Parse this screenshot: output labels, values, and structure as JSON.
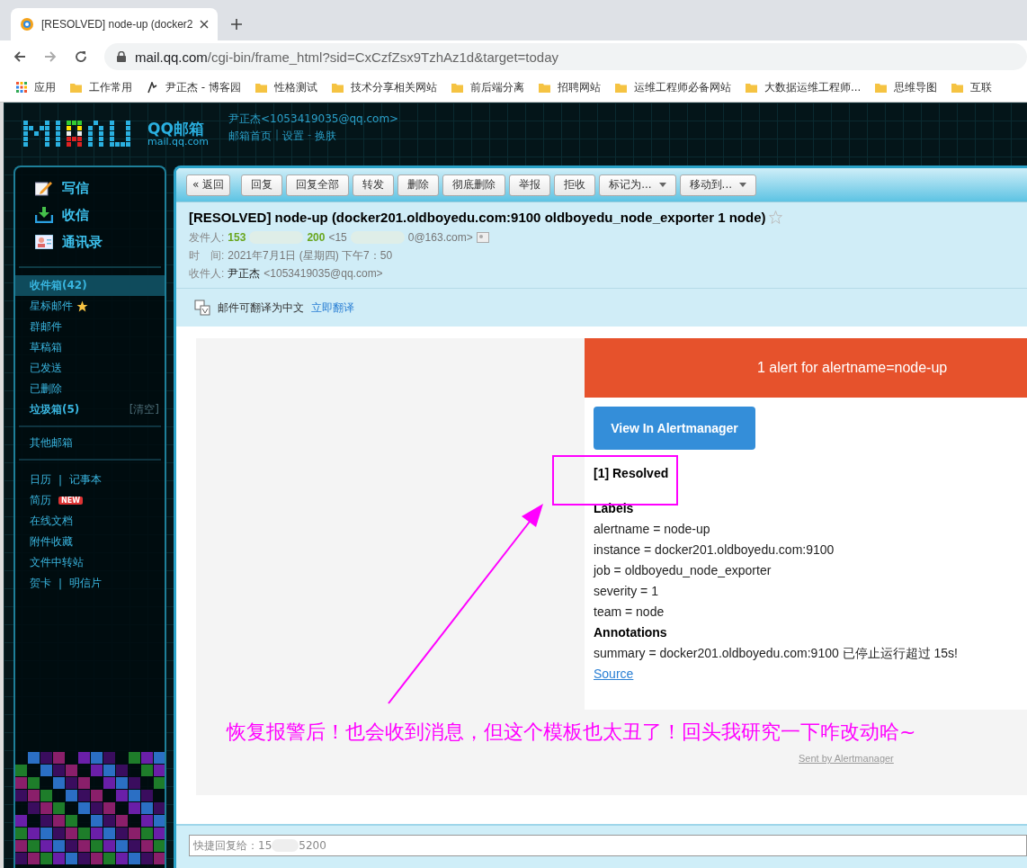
{
  "browser": {
    "tab_title": "[RESOLVED] node-up (docker2",
    "url_host": "mail.qq.com",
    "url_path": "/cgi-bin/frame_html?sid=CxCzfZsx9TzhAz1d&target=today",
    "bookmarks": [
      {
        "kind": "apps",
        "label": "应用"
      },
      {
        "kind": "folder",
        "label": "工作常用"
      },
      {
        "kind": "site",
        "label": "尹正杰 - 博客园"
      },
      {
        "kind": "folder",
        "label": "性格测试"
      },
      {
        "kind": "folder",
        "label": "技术分享相关网站"
      },
      {
        "kind": "folder",
        "label": "前后端分离"
      },
      {
        "kind": "folder",
        "label": "招聘网站"
      },
      {
        "kind": "folder",
        "label": "运维工程师必备网站"
      },
      {
        "kind": "folder",
        "label": "大数据运维工程师..."
      },
      {
        "kind": "folder",
        "label": "思维导图"
      },
      {
        "kind": "folder",
        "label": "互联"
      }
    ]
  },
  "header": {
    "brand": "QQ邮箱",
    "domain": "mail.qq.com",
    "user": "尹正杰<1053419035@qq.com>",
    "links": [
      "邮箱首页",
      "设置",
      "换肤"
    ],
    "separators": [
      "|",
      "-"
    ]
  },
  "sidebar": {
    "actions": [
      {
        "kind": "write",
        "label": "写信"
      },
      {
        "kind": "inbox",
        "label": "收信"
      },
      {
        "kind": "contacts",
        "label": "通讯录"
      }
    ],
    "folders": [
      {
        "label": "收件箱(42)",
        "bold": true,
        "selected": true
      },
      {
        "label": "星标邮件",
        "bold": false,
        "selected": false,
        "starred": true
      },
      {
        "label": "群邮件",
        "bold": false,
        "selected": false
      },
      {
        "label": "草稿箱",
        "bold": false,
        "selected": false
      },
      {
        "label": "已发送",
        "bold": false,
        "selected": false
      },
      {
        "label": "已删除",
        "bold": false,
        "selected": false
      },
      {
        "label": "垃圾箱(5)",
        "bold": true,
        "selected": false,
        "action": "[清空]"
      }
    ],
    "other": "其他邮箱",
    "separator": "|",
    "tools": [
      {
        "links": [
          "日历",
          "记事本"
        ]
      },
      {
        "links": [
          "简历"
        ],
        "badge": "NEW"
      },
      {
        "links": [
          "在线文档"
        ]
      },
      {
        "links": [
          "附件收藏"
        ]
      },
      {
        "links": [
          "文件中转站"
        ]
      },
      {
        "links": [
          "贺卡",
          "明信片"
        ]
      }
    ]
  },
  "toolbar": [
    {
      "label": "« 返回",
      "dropdown": false
    },
    {
      "label": "回复",
      "dropdown": false
    },
    {
      "label": "回复全部",
      "dropdown": false
    },
    {
      "label": "转发",
      "dropdown": false
    },
    {
      "label": "删除",
      "dropdown": false
    },
    {
      "label": "彻底删除",
      "dropdown": false
    },
    {
      "label": "举报",
      "dropdown": false
    },
    {
      "label": "拒收",
      "dropdown": false
    },
    {
      "label": "标记为...",
      "dropdown": true
    },
    {
      "label": "移动到...",
      "dropdown": true
    }
  ],
  "message": {
    "subject": "[RESOLVED] node-up (docker201.oldboyedu.com:9100 oldboyedu_node_exporter 1 node)",
    "from_label": "发件人:",
    "from_name_start": "153",
    "from_name_end": "200",
    "from_email_start": "<15",
    "from_email_end": "0@163.com>",
    "time_label": "时　间:",
    "time": "2021年7月1日 (星期四) 下午7：50",
    "to_label": "收件人:",
    "to_name": "尹正杰",
    "to_email": "<1053419035@qq.com>",
    "translate_note": "邮件可翻译为中文",
    "translate_link": "立即翻译"
  },
  "alert": {
    "banner": "1 alert for alertname=node-up",
    "button": "View In Alertmanager",
    "status": "[1] Resolved",
    "labels_heading": "Labels",
    "labels": [
      "alertname = node-up",
      "instance = docker201.oldboyedu.com:9100",
      "job = oldboyedu_node_exporter",
      "severity = 1",
      "team = node"
    ],
    "annotations_heading": "Annotations",
    "annotations": [
      "summary = docker201.oldboyedu.com:9100 已停止运行超过 15s!"
    ],
    "source_link": "Source",
    "footer": "Sent by Alertmanager"
  },
  "annotation_caption": "恢复报警后！也会收到消息，但这个模板也太丑了！回头我研究一下咋改动哈~",
  "quick_reply": {
    "placeholder_start": "快捷回复给：15",
    "placeholder_end": "5200"
  }
}
